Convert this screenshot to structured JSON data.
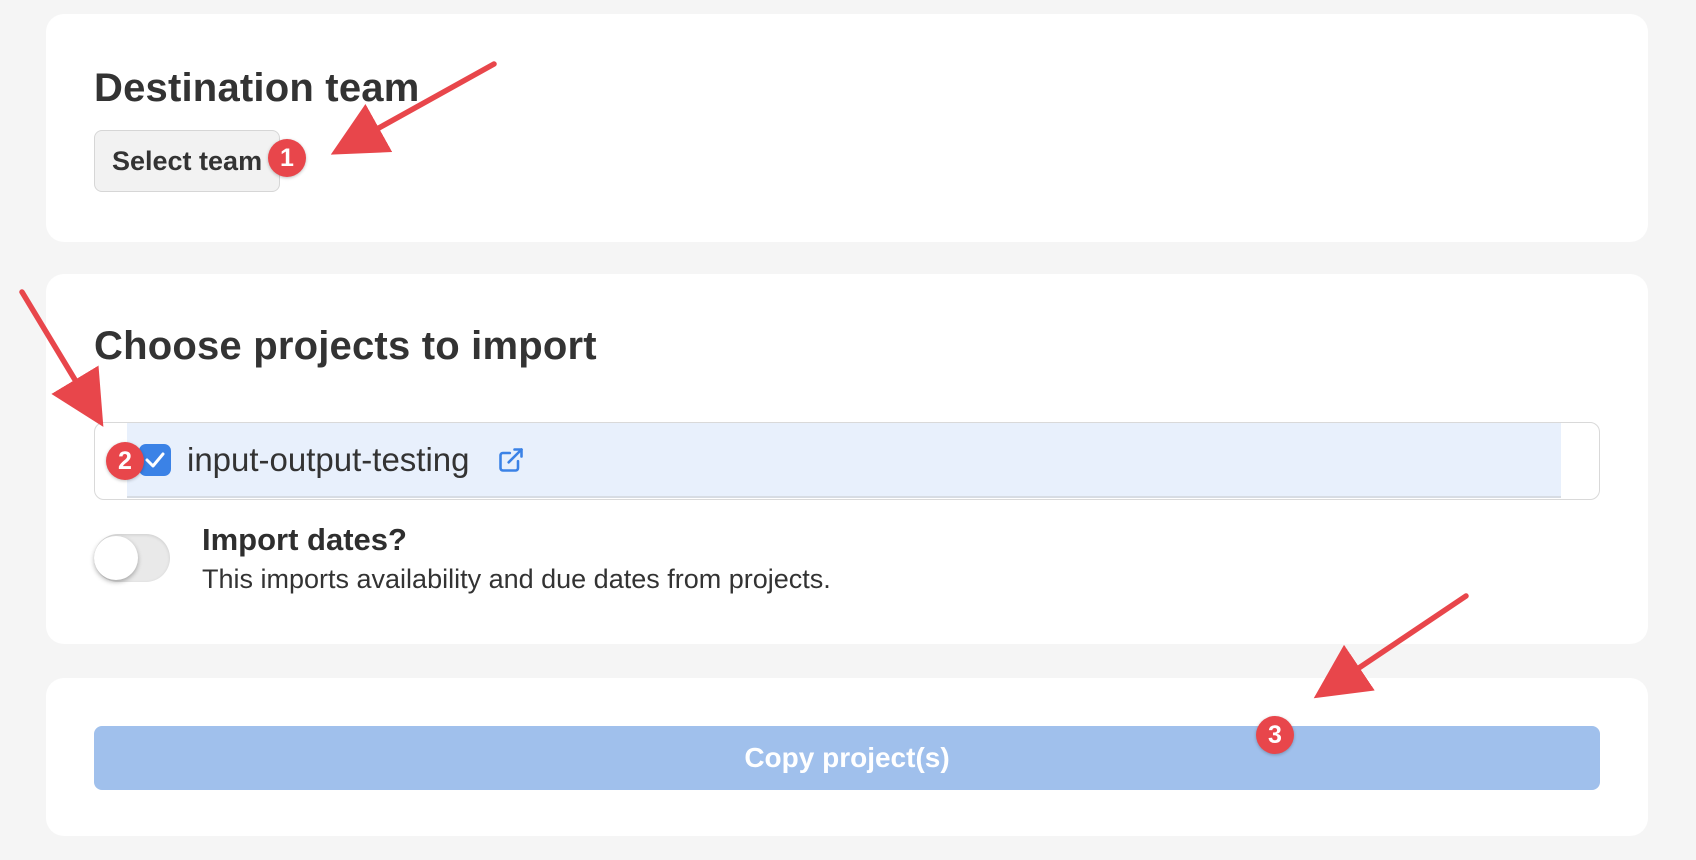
{
  "destination": {
    "title": "Destination team",
    "select_label": "Select team"
  },
  "projects": {
    "title": "Choose projects to import",
    "items": [
      {
        "name": "input-output-testing",
        "checked": true
      }
    ]
  },
  "import_dates": {
    "label": "Import dates?",
    "description": "This imports availability and due dates from projects.",
    "enabled": false
  },
  "action": {
    "copy_label": "Copy project(s)"
  },
  "annotations": {
    "badges": [
      "1",
      "2",
      "3"
    ]
  },
  "colors": {
    "accent": "#3b82e6",
    "annotation": "#e8464b",
    "disabled_button": "#a0c0ec",
    "selected_row": "#e8f0fc"
  },
  "icons": {
    "checkbox": "checkmark-icon",
    "project_link": "external-link-icon"
  }
}
